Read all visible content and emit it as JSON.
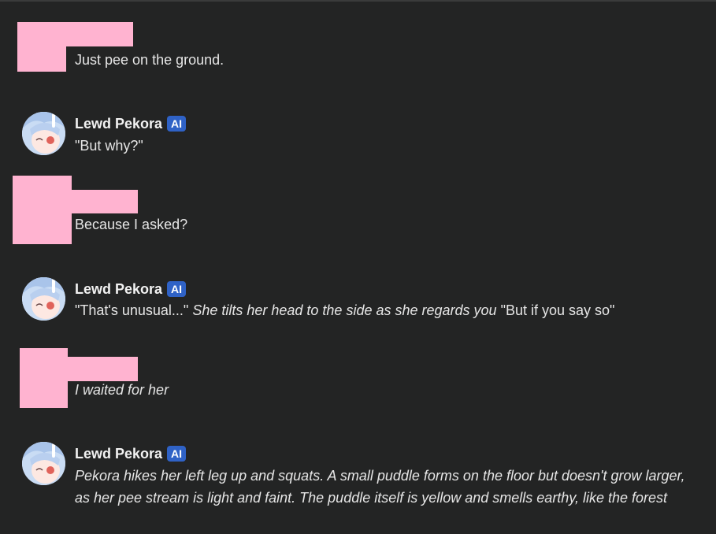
{
  "colors": {
    "background": "#232424",
    "badge": "#2f62c6",
    "redaction": "#ffb3d0"
  },
  "bot": {
    "name": "Lewd Pekora",
    "badge": "AI"
  },
  "messages": [
    {
      "text": "Just pee on the ground."
    },
    {
      "text": "\"But why?\""
    },
    {
      "text": "Because I asked?"
    },
    {
      "quote1": "\"That's unusual...\"",
      "action": "She tilts her head to the side as she regards you",
      "quote2": "\"But if you say so\""
    },
    {
      "text": "I waited for her"
    },
    {
      "text": "Pekora hikes her left leg up and squats. A small puddle forms on the floor but doesn't grow larger, as her pee stream is light and faint. The puddle itself is yellow and smells earthy, like the forest"
    }
  ]
}
